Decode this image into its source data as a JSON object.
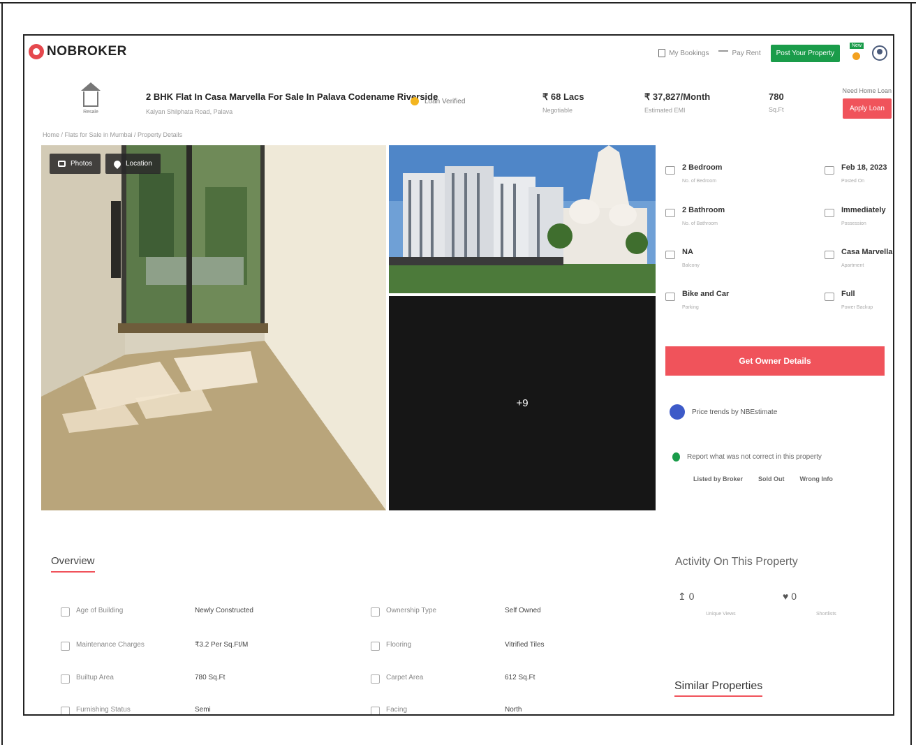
{
  "header": {
    "logo": "NOBROKER",
    "links": [
      {
        "label": "My Bookings",
        "icon": "document-icon"
      },
      {
        "label": "Pay Rent",
        "icon": "payment-icon"
      }
    ],
    "post_button": "Post Your Property",
    "new_badge": "New",
    "user_icon": "user-icon"
  },
  "property_bar": {
    "resale_label": "Resale",
    "title": "2 BHK Flat In Casa Marvella For Sale In Palava Codename Riverside",
    "address": "Kalyan Shilphata Road, Palava",
    "loan_status": "Loan Verified",
    "price": "₹ 68 Lacs",
    "price_sub": "Negotiable",
    "emi": "₹ 37,827/Month",
    "emi_sub": "Estimated EMI",
    "area": "780",
    "area_sub": "Sq.Ft",
    "home_loan_q": "Need Home Loan",
    "apply_button": "Apply Loan"
  },
  "breadcrumb": "Home / Flats for Sale in Mumbai / Property Details",
  "gallery": {
    "photos_button": "Photos",
    "location_button": "Location",
    "more_count": "+9"
  },
  "details": [
    {
      "value": "2 Bedroom",
      "sub": "No. of Bedroom",
      "icon": "bed-icon"
    },
    {
      "value": "Feb 18, 2023",
      "sub": "Posted On",
      "icon": "calendar-icon"
    },
    {
      "value": "2 Bathroom",
      "sub": "No. of Bathroom",
      "icon": "bath-icon"
    },
    {
      "value": "Immediately",
      "sub": "Possession",
      "icon": "key-icon"
    },
    {
      "value": "NA",
      "sub": "Balcony",
      "icon": "balcony-icon"
    },
    {
      "value": "Casa Marvella",
      "sub": "Apartment",
      "icon": "building-icon"
    },
    {
      "value": "Bike and Car",
      "sub": "Parking",
      "icon": "car-icon"
    },
    {
      "value": "Full",
      "sub": "Power Backup",
      "icon": "battery-icon"
    }
  ],
  "owner_button": "Get Owner Details",
  "price_trends": "Price trends by NBEstimate",
  "report": {
    "text": "Report what was not correct in this property",
    "options": [
      "Listed by Broker",
      "Sold Out",
      "Wrong Info"
    ]
  },
  "overview": {
    "title": "Overview",
    "rows": [
      {
        "label": "Age of Building",
        "value": "Newly Constructed",
        "label2": "Ownership Type",
        "value2": "Self Owned"
      },
      {
        "label": "Maintenance Charges",
        "value": "₹3.2 Per Sq.Ft/M",
        "label2": "Flooring",
        "value2": "Vitrified Tiles"
      },
      {
        "label": "Builtup Area",
        "value": "780 Sq.Ft",
        "label2": "Carpet Area",
        "value2": "612 Sq.Ft"
      },
      {
        "label": "Furnishing Status",
        "value": "Semi",
        "label2": "Facing",
        "value2": "North"
      }
    ]
  },
  "activity": {
    "title": "Activity On This Property",
    "views": "0",
    "views_label": "Unique Views",
    "shortlists": "0",
    "shortlists_label": "Shortlists"
  },
  "similar_title": "Similar Properties"
}
